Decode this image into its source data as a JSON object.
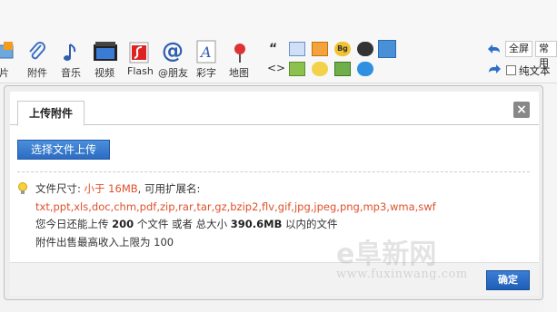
{
  "toolbar": {
    "items": [
      {
        "label": "图片",
        "icon": "image-icon"
      },
      {
        "label": "附件",
        "icon": "paperclip-icon"
      },
      {
        "label": "音乐",
        "icon": "music-note-icon"
      },
      {
        "label": "视频",
        "icon": "film-icon"
      },
      {
        "label": "Flash",
        "icon": "flash-icon"
      },
      {
        "label": "@朋友",
        "icon": "at-icon"
      },
      {
        "label": "彩字",
        "icon": "color-text-icon"
      },
      {
        "label": "地图",
        "icon": "map-pin-icon"
      }
    ],
    "small_icons_row1": [
      "quote-icon",
      "code-icon",
      "free-icon",
      "hide-icon",
      "qq-icon",
      "users-icon"
    ],
    "small_icons_row2": [
      "code-brackets-icon",
      "download-icon",
      "key-icon",
      "badge-icon",
      "ie-icon"
    ],
    "fullscreen_label": "全屏",
    "common_label": "常用",
    "plaintext_label": "纯文本"
  },
  "dialog": {
    "tab_label": "上传附件",
    "upload_button": "选择文件上传",
    "size_prefix": "文件尺寸: ",
    "size_limit": "小于 16MB",
    "ext_label": ", 可用扩展名:",
    "extensions": "txt,ppt,xls,doc,chm,pdf,zip,rar,tar,gz,bzip2,flv,gif,jpg,jpeg,png,mp3,wma,swf",
    "quota_prefix": "您今日还能上传 ",
    "quota_count": "200",
    "quota_mid": " 个文件 或者 总大小 ",
    "quota_size": "390.6MB",
    "quota_suffix": " 以内的文件",
    "sale_limit": "附件出售最高收入上限为 100",
    "ok_button": "确定"
  },
  "watermark": {
    "big": "e阜新网",
    "url": "www.fuxinwang.com"
  }
}
